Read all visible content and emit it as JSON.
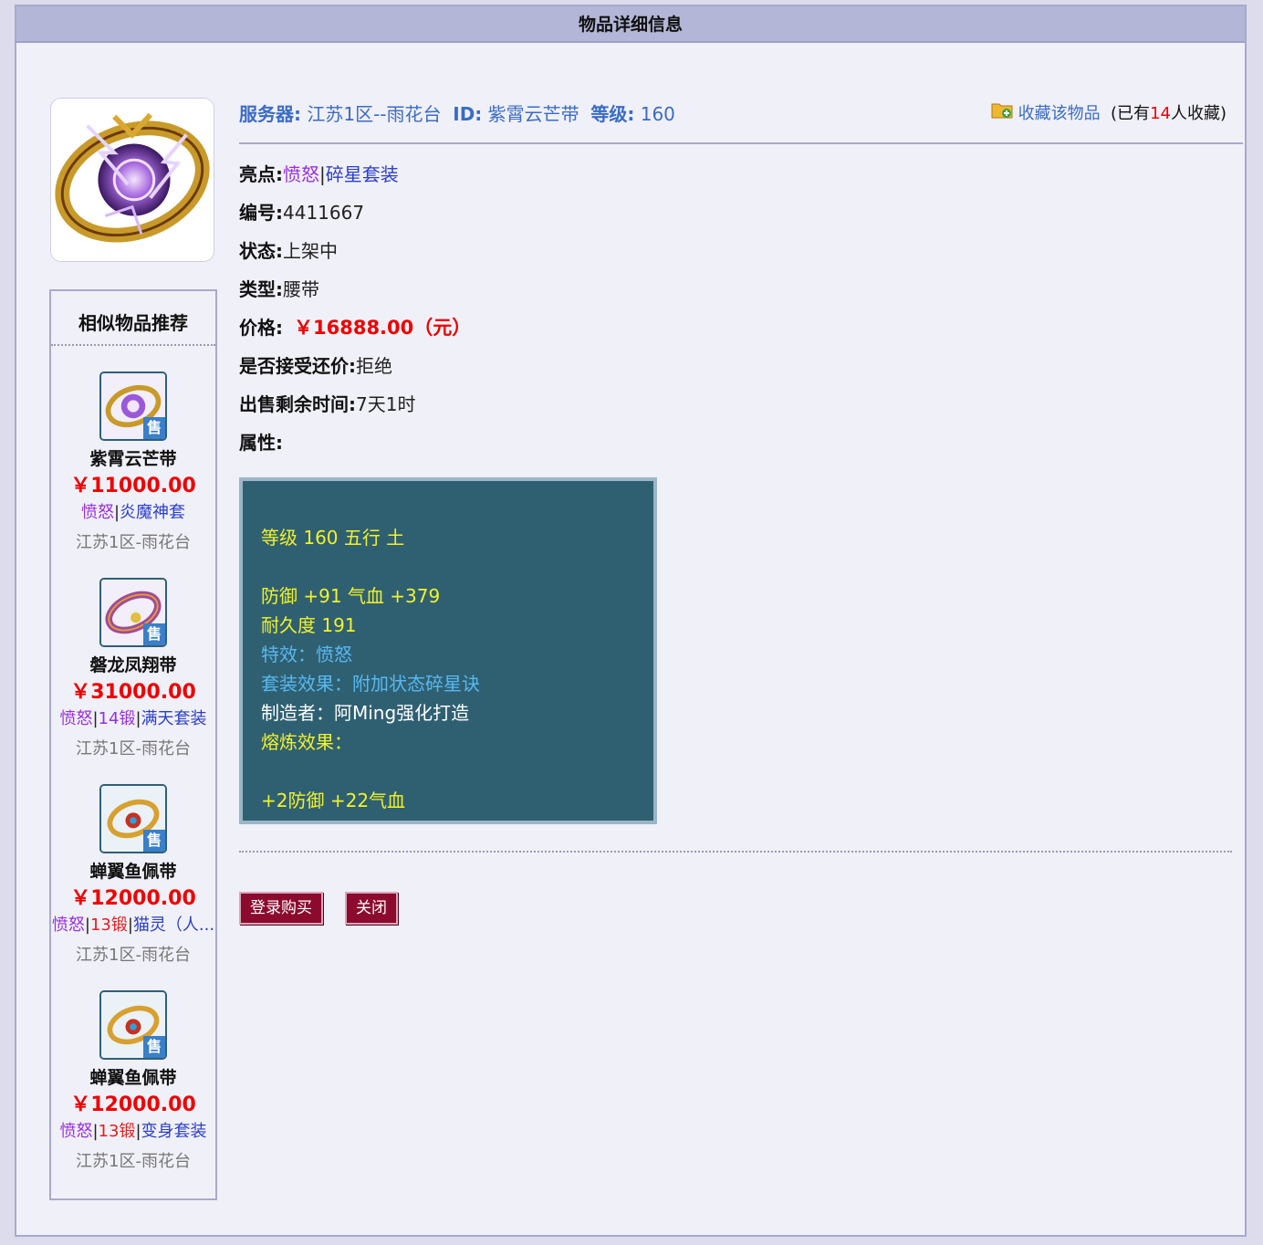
{
  "page_title": "物品详细信息",
  "header": {
    "server_label": "服务器:",
    "server_value": "江苏1区--雨花台",
    "id_label": "ID:",
    "id_value": "紫霄云芒带",
    "level_label": "等级:",
    "level_value": "160",
    "favorite_link": "收藏该物品",
    "favorite_prefix": "(已有",
    "favorite_count": "14",
    "favorite_suffix": "人收藏)"
  },
  "details": {
    "highlight_label": "亮点:",
    "highlight_tag1": "愤怒",
    "highlight_sep": "|",
    "highlight_tag2": "碎星套装",
    "number_label": "编号:",
    "number_value": "4411667",
    "status_label": "状态:",
    "status_value": "上架中",
    "type_label": "类型:",
    "type_value": "腰带",
    "price_label": "价格:",
    "price_value": "￥16888.00（元）",
    "bargain_label": "是否接受还价:",
    "bargain_value": "拒绝",
    "remaining_label": "出售剩余时间:",
    "remaining_value": "7天1时",
    "attributes_label": "属性:"
  },
  "attributes": {
    "line1": "等级 160 五行 土",
    "line2": "防御 +91 气血 +379",
    "line3": "耐久度 191",
    "line4": "特效：愤怒",
    "line5": "套装效果：附加状态碎星诀",
    "line6": "制造者：阿Ming强化打造",
    "line7": "熔炼效果：",
    "line8": "+2防御 +22气血"
  },
  "buttons": {
    "buy": "登录购买",
    "close": "关闭"
  },
  "sidebar": {
    "title": "相似物品推荐",
    "sale_badge": "售",
    "items": [
      {
        "name": "紫霄云芒带",
        "price": "￥11000.00",
        "tag1": "愤怒",
        "tag2": "",
        "tag3": "炎魔神套",
        "server": "江苏1区-雨花台"
      },
      {
        "name": "磐龙凤翔带",
        "price": "￥31000.00",
        "tag1": "愤怒",
        "tag2": "14锻",
        "tag3": "满天套装",
        "server": "江苏1区-雨花台"
      },
      {
        "name": "蝉翼鱼佩带",
        "price": "￥12000.00",
        "tag1": "愤怒",
        "tag2": "13锻",
        "tag3": "猫灵（人...",
        "server": "江苏1区-雨花台"
      },
      {
        "name": "蝉翼鱼佩带",
        "price": "￥12000.00",
        "tag1": "愤怒",
        "tag2": "13锻",
        "tag3": "变身套装",
        "server": "江苏1区-雨花台"
      }
    ]
  },
  "colors": {
    "title_bar": "#b3b6d6",
    "price_red": "#e00000",
    "link_blue": "#3a6cc4",
    "attr_bg": "#2f6072",
    "attr_yellow": "#f2f22a",
    "button_bg": "#8b0a2e"
  },
  "icons": {
    "main_item": "belt-item-icon",
    "favorite": "folder-add-icon"
  }
}
